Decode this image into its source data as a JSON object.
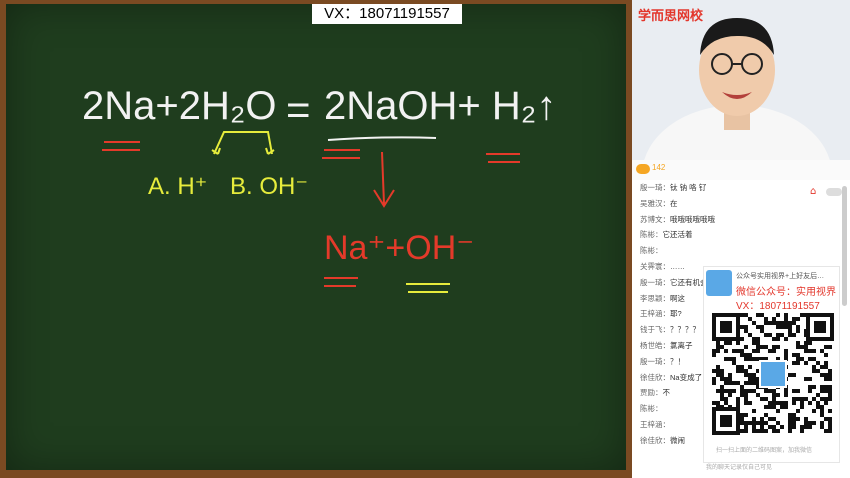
{
  "watermark": "VX：18071191557",
  "board": {
    "equation_left": "2Na+2H₂O",
    "equals": "=",
    "equation_right": "2NaOH+ H₂↑",
    "option_a": "A. H⁺",
    "option_b": "B. OH⁻",
    "ions": "Na⁺+OH⁻"
  },
  "video": {
    "brand": "学而思网校"
  },
  "chat": {
    "count": "142",
    "messages": [
      {
        "name": "殷一琦：",
        "text": "钛 钠 咯 钌"
      },
      {
        "name": "吴雅汉：",
        "text": "在"
      },
      {
        "name": "苏博文：",
        "text": "哦哦哦哦哦哦"
      },
      {
        "name": "陈彬：",
        "text": "它还活着"
      },
      {
        "name": "陈彬：",
        "text": ""
      },
      {
        "name": "关霁寰：",
        "text": "……"
      },
      {
        "name": "殷一琦：",
        "text": "它还有机会"
      },
      {
        "name": "李思颖：",
        "text": "啊这"
      },
      {
        "name": "王梓涵：",
        "text": "耶?"
      },
      {
        "name": "钱于飞：",
        "text": "？？？？"
      },
      {
        "name": "杨世皓：",
        "text": "氯离子"
      },
      {
        "name": "殷一琦：",
        "text": "？！"
      },
      {
        "name": "徐佳欣：",
        "text": "Na变成了"
      },
      {
        "name": "贾励：",
        "text": "不"
      },
      {
        "name": "陈彬：",
        "text": ""
      },
      {
        "name": "王梓涵：",
        "text": ""
      },
      {
        "name": "徐佳欣：",
        "text": "微闹"
      }
    ]
  },
  "ad": {
    "line1": "公众号实用视界+上好友后…",
    "line2": "微信公众号：实用视界",
    "line3": "VX：18071191557",
    "footer": "扫一扫上面的二维码图案，加我微信",
    "footer2": "我的聊天记录仅自己可见"
  },
  "colors": {
    "board": "#1f3d1e",
    "frame": "#7a4a22",
    "red": "#e3362b"
  }
}
